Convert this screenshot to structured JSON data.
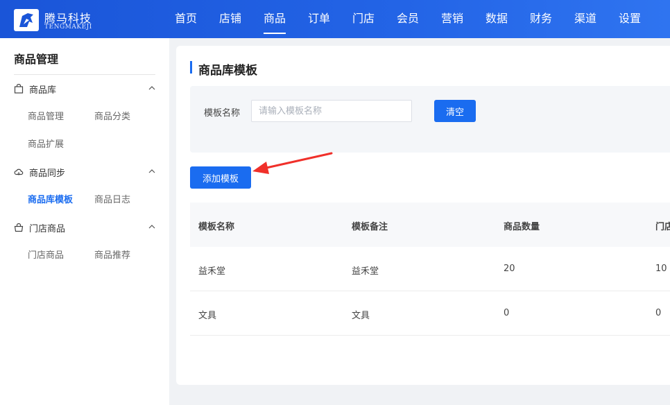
{
  "brand": {
    "name": "腾马科技",
    "sub": "TENGMAKEJI"
  },
  "nav": [
    {
      "label": "首页",
      "active": false
    },
    {
      "label": "店铺",
      "active": false
    },
    {
      "label": "商品",
      "active": true
    },
    {
      "label": "订单",
      "active": false
    },
    {
      "label": "门店",
      "active": false
    },
    {
      "label": "会员",
      "active": false
    },
    {
      "label": "营销",
      "active": false
    },
    {
      "label": "数据",
      "active": false
    },
    {
      "label": "财务",
      "active": false
    },
    {
      "label": "渠道",
      "active": false
    },
    {
      "label": "设置",
      "active": false
    }
  ],
  "sidebar": {
    "title": "商品管理",
    "groups": [
      {
        "label": "商品库",
        "icon": "bag-icon",
        "items": [
          "商品管理",
          "商品分类",
          "商品扩展"
        ]
      },
      {
        "label": "商品同步",
        "icon": "cloud-sync-icon",
        "items": [
          "商品库模板",
          "商品日志"
        ]
      },
      {
        "label": "门店商品",
        "icon": "basket-icon",
        "items": [
          "门店商品",
          "商品推荐"
        ]
      }
    ],
    "active_item": "商品库模板"
  },
  "page": {
    "title": "商品库模板",
    "filter": {
      "label": "模板名称",
      "placeholder": "请输入模板名称",
      "value": "",
      "clear_label": "清空"
    },
    "add_label": "添加模板",
    "table": {
      "headers": [
        "模板名称",
        "模板备注",
        "商品数量",
        "门店"
      ],
      "rows": [
        [
          "益禾堂",
          "益禾堂",
          "20",
          "10"
        ],
        [
          "文具",
          "文具",
          "0",
          "0"
        ]
      ]
    }
  },
  "colors": {
    "accent": "#1a6cf0",
    "topbar": "#2364e6",
    "annotation_arrow": "#f0302a"
  }
}
